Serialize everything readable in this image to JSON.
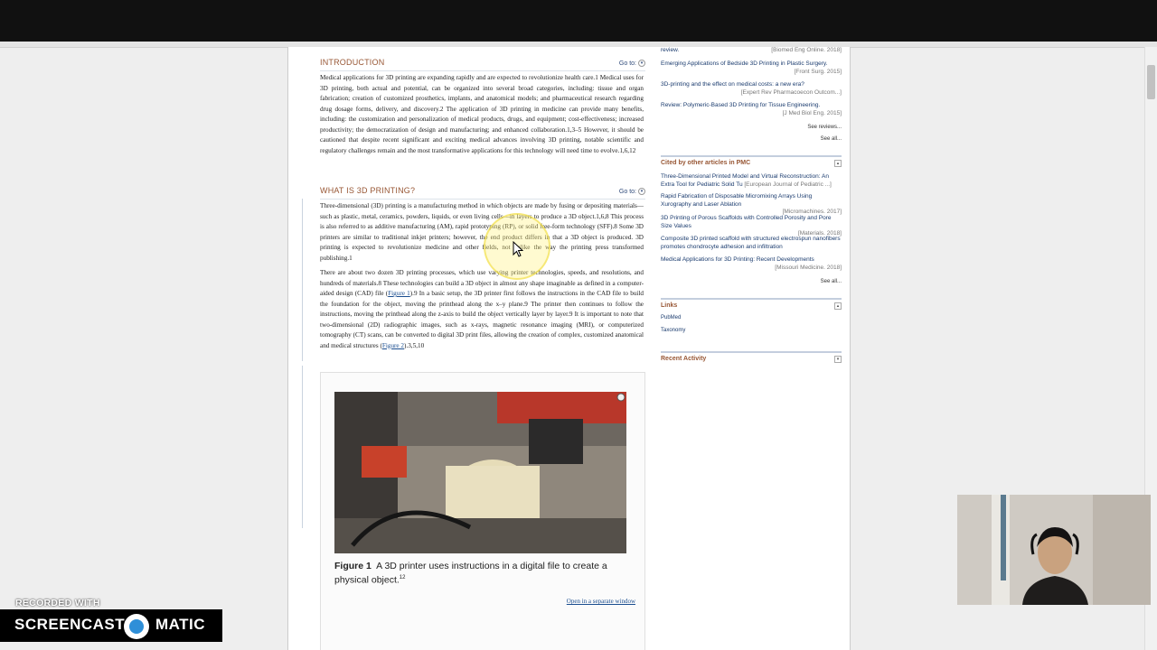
{
  "watermark": {
    "recorded_with": "RECORDED WITH",
    "brand_left": "SCREENCAST",
    "brand_right": "MATIC"
  },
  "article": {
    "intro": {
      "title": "INTRODUCTION",
      "goto": "Go to:",
      "paragraph": "Medical applications for 3D printing are expanding rapidly and are expected to revolutionize health care.1 Medical uses for 3D printing, both actual and potential, can be organized into several broad categories, including: tissue and organ fabrication; creation of customized prosthetics, implants, and anatomical models; and pharmaceutical research regarding drug dosage forms, delivery, and discovery.2 The application of 3D printing in medicine can provide many benefits, including: the customization and personalization of medical products, drugs, and equipment; cost-effectiveness; increased productivity; the democratization of design and manufacturing; and enhanced collaboration.1,3–5 However, it should be cautioned that despite recent significant and exciting medical advances involving 3D printing, notable scientific and regulatory challenges remain and the most transformative applications for this technology will need time to evolve.1,6,12"
    },
    "what": {
      "title": "WHAT IS 3D PRINTING?",
      "goto": "Go to:",
      "paragraph1": "Three-dimensional (3D) printing is a manufacturing method in which objects are made by fusing or depositing materials—such as plastic, metal, ceramics, powders, liquids, or even living cells—in layers to produce a 3D object.1,6,8 This process is also referred to as additive manufacturing (AM), rapid prototyping (RP), or solid free-form technology (SFF).8 Some 3D printers are similar to traditional inkjet printers; however, the end product differs in that a 3D object is produced. 3D printing is expected to revolutionize medicine and other fields, not unlike the way the printing press transformed publishing.1",
      "paragraph2_a": "There are about two dozen 3D printing processes, which use varying printer technologies, speeds, and resolutions, and hundreds of materials.8 These technologies can build a 3D object in almost any shape imaginable as defined in a computer-aided design (CAD) file (",
      "fig1_link": "Figure 1",
      "paragraph2_b": ").9 In a basic setup, the 3D printer first follows the instructions in the CAD file to build the foundation for the object, moving the printhead along the x–y plane.9 The printer then continues to follow the instructions, moving the printhead along the z-axis to build the object vertically layer by layer.9 It is important to note that two-dimensional (2D) radiographic images, such as x-rays, magnetic resonance imaging (MRI), or computerized tomography (CT) scans, can be converted to digital 3D print files, allowing the creation of complex, customized anatomical and medical structures (",
      "fig2_link": "Figure 2",
      "paragraph2_c": ").3,5,10"
    },
    "figure": {
      "label": "Figure 1",
      "caption": "A 3D printer uses instructions in a digital file to create a physical object.",
      "caption_ref": "12",
      "open_window": "Open in a separate window"
    }
  },
  "sidebar": {
    "reviews": [
      {
        "title": "review.",
        "source": "[Biomed Eng Online. 2018]"
      },
      {
        "title": "Emerging Applications of Bedside 3D Printing in Plastic Surgery.",
        "source": "[Front Surg. 2015]"
      },
      {
        "title": "3D-printing and the effect on medical costs: a new era?",
        "source": "[Expert Rev Pharmacoecon Outcom...]"
      },
      {
        "title": "Review: Polymeric-Based 3D Printing for Tissue Engineering.",
        "source": "[J Med Biol Eng. 2015]"
      }
    ],
    "see_reviews": "See reviews...",
    "see_all_1": "See all...",
    "cited_title": "Cited by other articles in PMC",
    "cited": [
      {
        "title": "Three-Dimensional Printed Model and Virtual Reconstruction: An Extra Tool for Pediatric Solid Tu",
        "source": "[European Journal of Pediatric ...]"
      },
      {
        "title": "Rapid Fabrication of Disposable Micromixing Arrays Using Xurography and Laser Ablation",
        "source": "[Micromachines. 2017]"
      },
      {
        "title": "3D Printing of Porous Scaffolds with Controlled Porosity and Pore Size Values",
        "source": "[Materials. 2018]"
      },
      {
        "title": "Composite 3D printed scaffold with structured electrospun nanofibers promotes chondrocyte adhesion and infiltration",
        "source": ""
      },
      {
        "title": "Medical Applications for 3D Printing: Recent Developments",
        "source": "[Missouri Medicine. 2018]"
      }
    ],
    "see_all_2": "See all...",
    "links_title": "Links",
    "links": [
      "PubMed",
      "Taxonomy"
    ],
    "activity_title": "Recent Activity"
  }
}
